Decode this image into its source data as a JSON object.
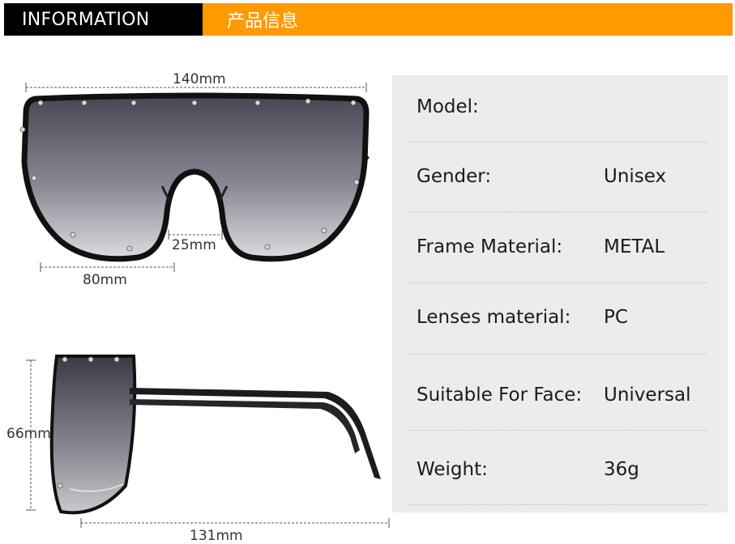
{
  "header": {
    "left_title": "INFORMATION",
    "right_title": "产品信息"
  },
  "dimensions": {
    "width": "140mm",
    "bridge": "25mm",
    "lens_width": "80mm",
    "height": "66mm",
    "temple": "131mm"
  },
  "specs": [
    {
      "label": "Model:",
      "value": ""
    },
    {
      "label": "Gender:",
      "value": "Unisex"
    },
    {
      "label": "Frame Material:",
      "value": "METAL"
    },
    {
      "label": "Lenses material:",
      "value": "PC"
    },
    {
      "label": "Suitable For Face:",
      "value": "Universal"
    },
    {
      "label": "Weight:",
      "value": "36g"
    }
  ],
  "colors": {
    "header_left": "#000000",
    "header_right": "#ff9a00",
    "panel": "#ececec"
  }
}
